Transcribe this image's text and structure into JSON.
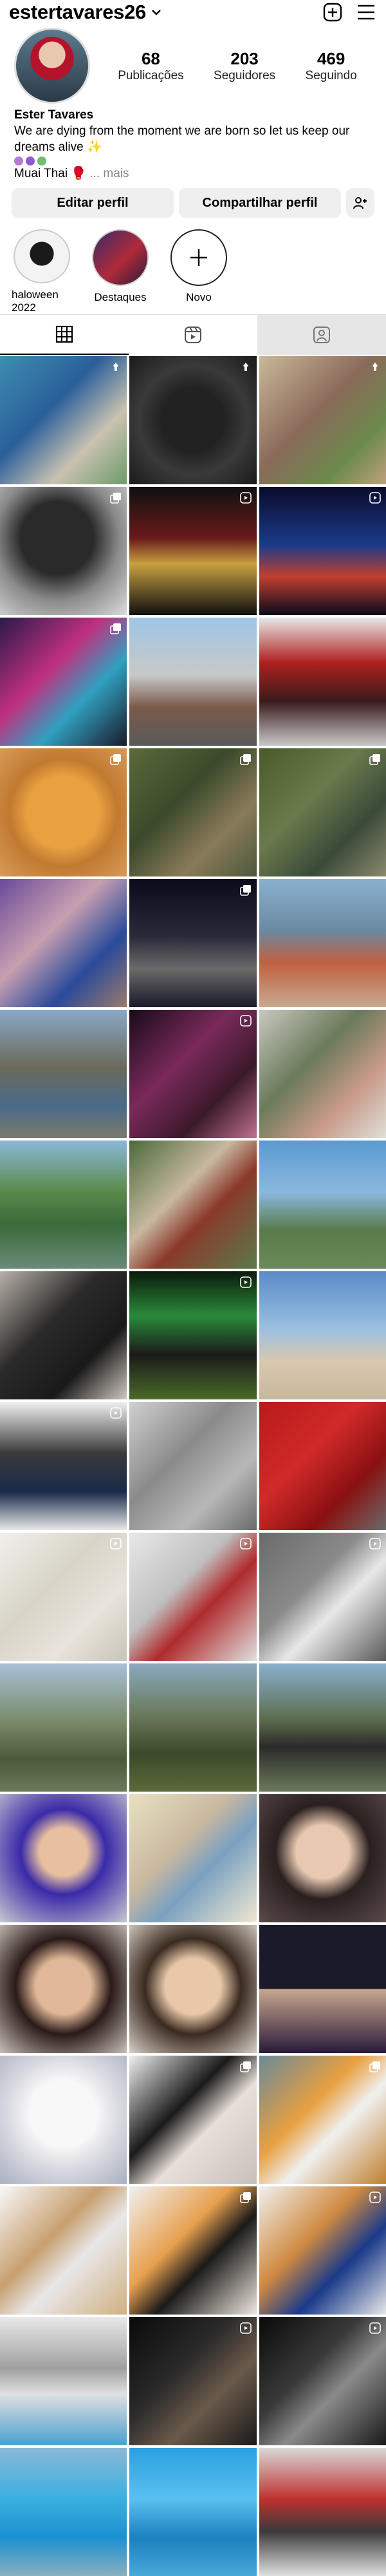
{
  "header": {
    "username": "estertavares26",
    "chevron_icon": "chevron-down-icon",
    "new_post_icon": "plus-square-icon",
    "menu_icon": "hamburger-menu-icon"
  },
  "profile": {
    "posts_count": "68",
    "posts_label": "Publicações",
    "followers_count": "203",
    "followers_label": "Seguidores",
    "following_count": "469",
    "following_label": "Seguindo"
  },
  "bio": {
    "name": "Ester Tavares",
    "line1": "We are dying from the moment we are born so let us keep our",
    "line2": "dreams alive ✨",
    "interests": "Muai Thai 🥊",
    "more": "... mais"
  },
  "actions": {
    "edit_profile": "Editar perfil",
    "share_profile": "Compartilhar perfil",
    "add_person_icon": "add-person-icon"
  },
  "highlights": [
    {
      "label": "haloween 2022"
    },
    {
      "label": "Destaques"
    },
    {
      "label": "Novo"
    }
  ],
  "tabs": [
    {
      "name": "grid-icon"
    },
    {
      "name": "reels-icon"
    },
    {
      "name": "tagged-icon"
    }
  ],
  "colors": {
    "button_bg": "#efefef",
    "tab_shade": "#e6e6e6"
  }
}
